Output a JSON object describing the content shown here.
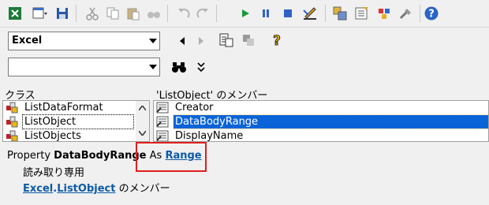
{
  "toolbar": {
    "icons": [
      "excel-view-icon",
      "insert-userform-icon",
      "save-icon",
      "cut-icon",
      "copy-icon",
      "paste-icon",
      "find-icon",
      "undo-icon",
      "redo-icon",
      "run-icon",
      "break-icon",
      "reset-icon",
      "design-mode-icon",
      "project-explorer-icon",
      "properties-icon",
      "object-browser-icon",
      "toolbox-icon",
      "help-icon"
    ]
  },
  "search": {
    "library_value": "Excel",
    "search_value": ""
  },
  "classes_pane": {
    "header": "クラス",
    "items": [
      {
        "label": "ListDataFormat"
      },
      {
        "label": "ListObject"
      },
      {
        "label": "ListObjects"
      }
    ]
  },
  "members_pane": {
    "header": "'ListObject' のメンバー",
    "items": [
      {
        "label": "Creator"
      },
      {
        "label": "DataBodyRange"
      },
      {
        "label": "DisplayName"
      }
    ]
  },
  "details": {
    "prefix": "Property ",
    "member_name": "DataBodyRange",
    "as_text": " As ",
    "type_link": "Range",
    "readonly_text": "読み取り専用",
    "library_link": "Excel",
    "dot": ".",
    "class_link": "ListObject",
    "member_of_text": " のメンバー"
  },
  "colors": {
    "selection": "#0a64d8",
    "link": "#0b5aa6",
    "highlight_box": "#e11d1d"
  }
}
